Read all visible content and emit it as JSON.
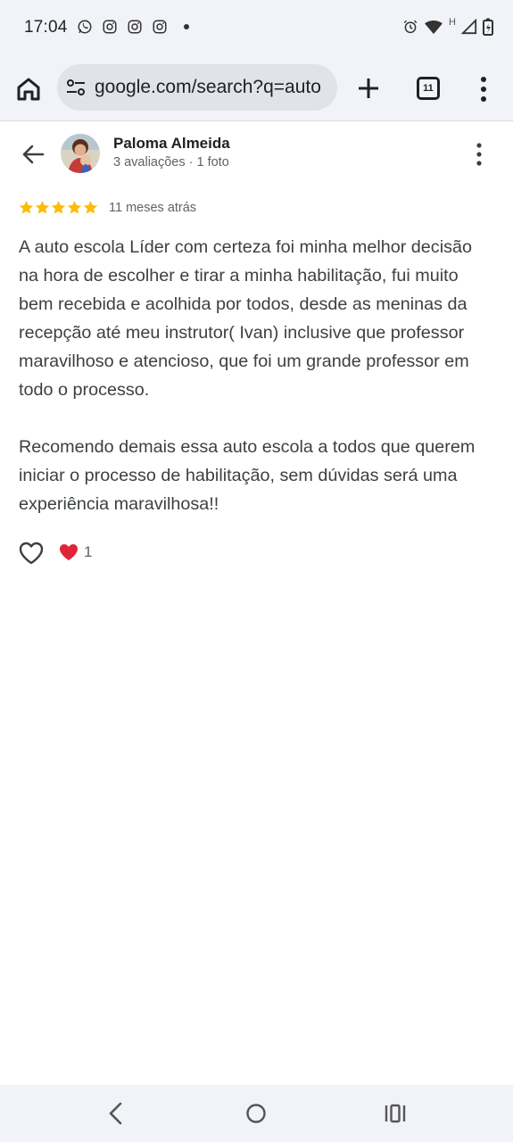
{
  "status_bar": {
    "time": "17:04",
    "left_icons": [
      "whatsapp-icon",
      "instagram-icon",
      "instagram-icon",
      "instagram-icon",
      "dot-icon"
    ],
    "right_icons": [
      "alarm-icon",
      "wifi-icon",
      "h-network-icon",
      "signal-icon",
      "battery-charging-icon"
    ],
    "network_label": "H"
  },
  "browser": {
    "url": "google.com/search?q=auto",
    "tab_count": "11"
  },
  "review": {
    "reviewer_name": "Paloma Almeida",
    "reviewer_meta": "3 avaliações · 1 foto",
    "rating": 5,
    "date": "11 meses atrás",
    "paragraph_1": "A auto escola Líder com certeza foi minha melhor decisão na hora de escolher e tirar a minha habilitação, fui muito bem recebida e acolhida por todos, desde as meninas da recepção até meu instrutor( Ivan) inclusive que professor maravilhoso e atencioso, que foi um grande professor em todo o processo.",
    "paragraph_2": "Recomendo demais essa auto escola a todos que querem iniciar o processo de habilitação, sem dúvidas será uma experiência maravilhosa!!",
    "reaction_count": "1"
  },
  "colors": {
    "star": "#fbbc04",
    "heart_reaction": "#e0243a",
    "bar_background": "#f1f3f8"
  }
}
